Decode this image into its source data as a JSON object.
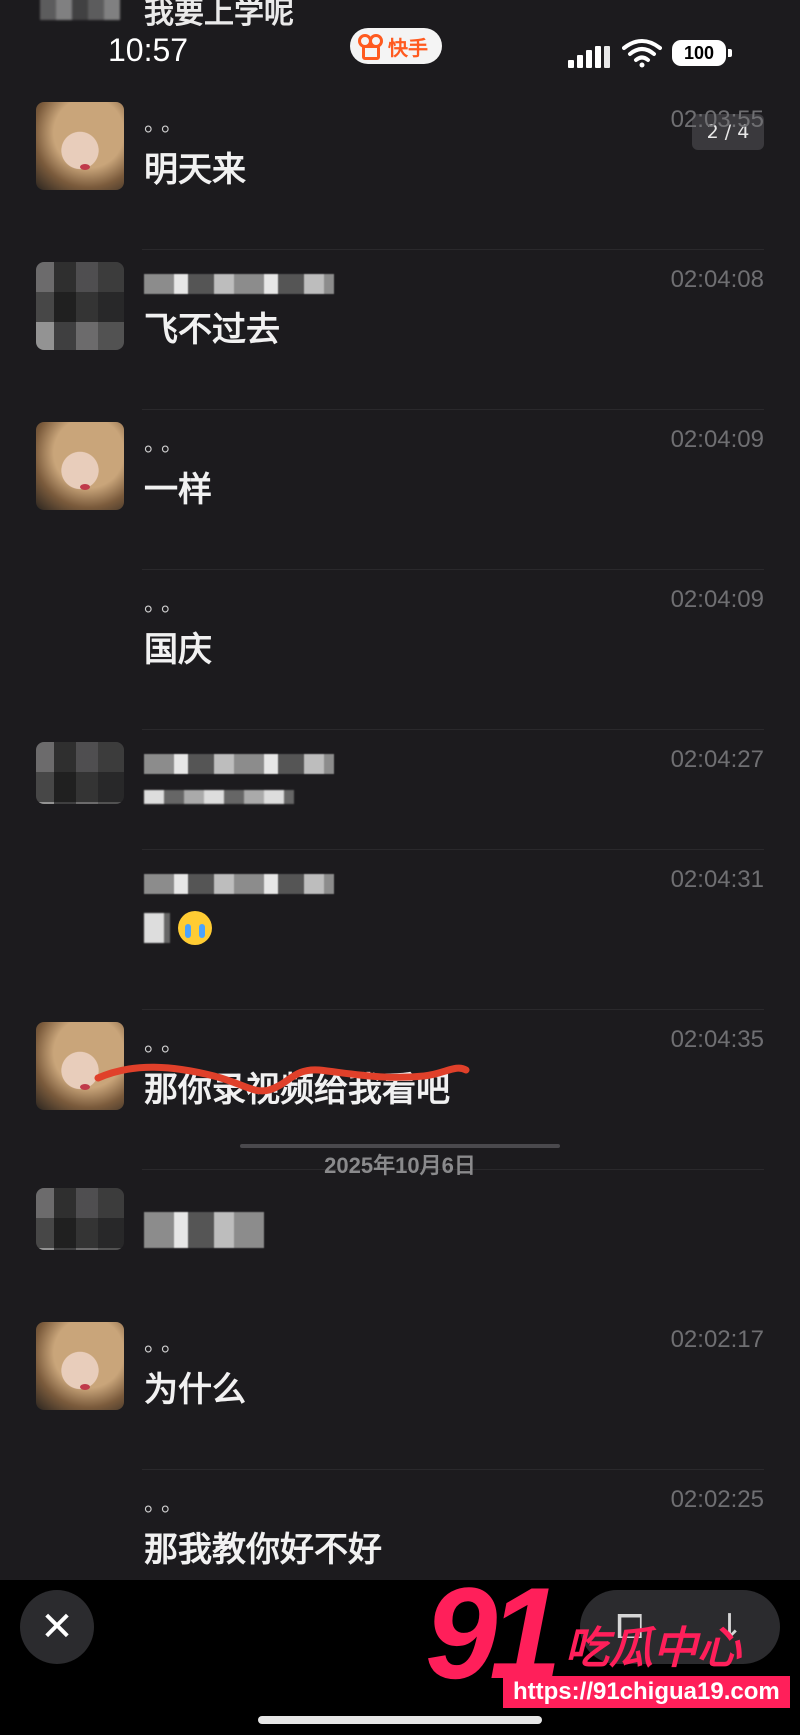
{
  "top_partial": {
    "text": "我要上学呢"
  },
  "status": {
    "time": "10:57",
    "app_name": "快手",
    "battery": "100"
  },
  "pager": "2 / 4",
  "messages": [
    {
      "sender": "。。",
      "sender_masked": false,
      "avatar": "photo",
      "time": "02:03:55",
      "text": "明天来"
    },
    {
      "sender": "",
      "sender_masked": true,
      "avatar": "blurred",
      "time": "02:04:08",
      "text": "飞不过去"
    },
    {
      "sender": "。。",
      "sender_masked": false,
      "avatar": "photo",
      "time": "02:04:09",
      "text": "一样"
    },
    {
      "sender": "。。",
      "sender_masked": false,
      "avatar": "none",
      "time": "02:04:09",
      "text": "国庆"
    },
    {
      "sender": "",
      "sender_masked": true,
      "avatar": "blurred",
      "time": "02:04:27",
      "text": ""
    },
    {
      "sender": "",
      "sender_masked": true,
      "avatar": "none",
      "time": "02:04:31",
      "text": ""
    },
    {
      "sender": "。。",
      "sender_masked": false,
      "avatar": "photo",
      "time": "02:04:35",
      "text": "那你录视频给我看吧"
    },
    {
      "sender": "",
      "sender_masked": true,
      "avatar": "blurred",
      "time": "",
      "text": ""
    },
    {
      "sender": "。。",
      "sender_masked": false,
      "avatar": "photo",
      "time": "02:02:17",
      "text": "为什么"
    },
    {
      "sender": "。。",
      "sender_masked": false,
      "avatar": "none",
      "time": "02:02:25",
      "text": "那我教你好不好"
    }
  ],
  "date_separator": "2025年10月6日",
  "watermark": {
    "number": "91",
    "name": "吃瓜中心",
    "url": "https://91chigua19.com"
  },
  "icons": {
    "close": "close-icon",
    "crop": "crop-icon",
    "download": "download-icon"
  },
  "colors": {
    "background": "#1c1b1e",
    "accent": "#ff5a1f",
    "watermark": "#ff1f5a",
    "annotation": "#e0402a"
  }
}
